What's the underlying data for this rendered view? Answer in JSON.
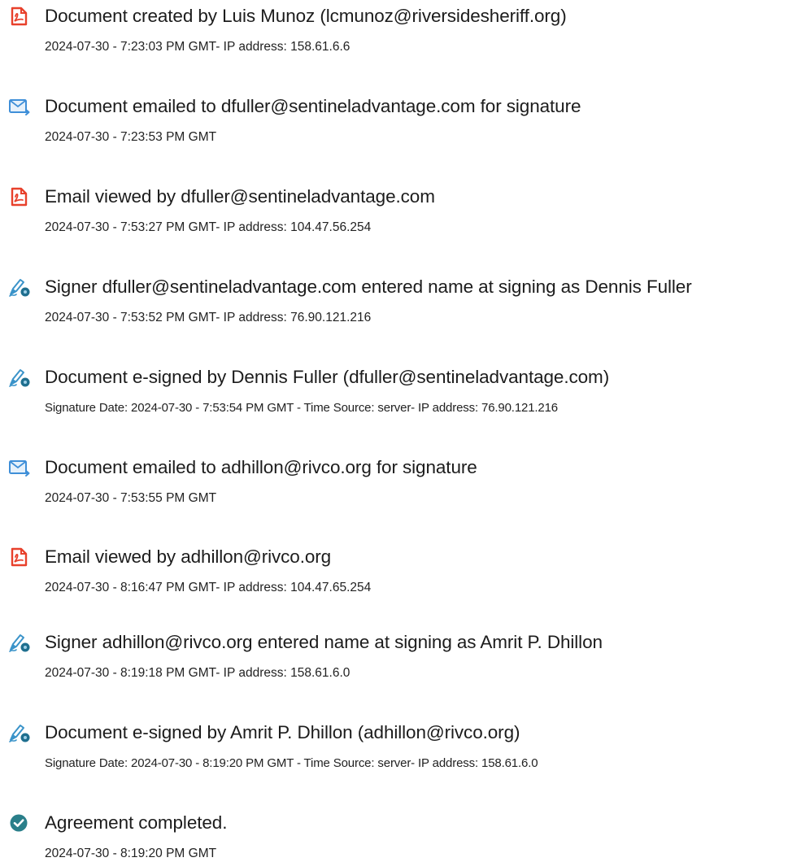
{
  "events": [
    {
      "icon": "pdf-document-icon",
      "title": "Document created by Luis Munoz (lcmunoz@riversidesheriff.org)",
      "detail": "2024-07-30 - 7:23:03 PM GMT- IP address: 158.61.6.6"
    },
    {
      "icon": "email-sent-icon",
      "title": "Document emailed to dfuller@sentineladvantage.com for signature",
      "detail": "2024-07-30 - 7:23:53 PM GMT"
    },
    {
      "icon": "pdf-document-icon",
      "title": "Email viewed by dfuller@sentineladvantage.com",
      "detail": "2024-07-30 - 7:53:27 PM GMT- IP address: 104.47.56.254"
    },
    {
      "icon": "signature-pen-icon",
      "title": "Signer dfuller@sentineladvantage.com entered name at signing as Dennis Fuller",
      "detail": "2024-07-30 - 7:53:52 PM GMT- IP address: 76.90.121.216"
    },
    {
      "icon": "signature-pen-icon",
      "title": "Document e-signed by Dennis Fuller (dfuller@sentineladvantage.com)",
      "detail": "Signature Date: 2024-07-30 - 7:53:54 PM GMT - Time Source: server- IP address: 76.90.121.216"
    },
    {
      "icon": "email-sent-icon",
      "title": "Document emailed to adhillon@rivco.org for signature",
      "detail": "2024-07-30 - 7:53:55 PM GMT"
    },
    {
      "icon": "pdf-document-icon",
      "title": "Email viewed by adhillon@rivco.org",
      "detail": "2024-07-30 - 8:16:47 PM GMT- IP address: 104.47.65.254"
    },
    {
      "icon": "signature-pen-icon",
      "title": "Signer adhillon@rivco.org entered name at signing as Amrit P. Dhillon",
      "detail": "2024-07-30 - 8:19:18 PM GMT- IP address: 158.61.6.0"
    },
    {
      "icon": "signature-pen-icon",
      "title": "Document e-signed by Amrit P. Dhillon (adhillon@rivco.org)",
      "detail": "Signature Date: 2024-07-30 - 8:19:20 PM GMT - Time Source: server- IP address: 158.61.6.0"
    },
    {
      "icon": "checkmark-circle-icon",
      "title": "Agreement completed.",
      "detail": "2024-07-30 - 8:19:20 PM GMT"
    }
  ],
  "colors": {
    "pdf_icon": "#e8412c",
    "email_icon": "#3f8fd8",
    "pen_icon": "#3a93c9",
    "pen_badge": "#1f6f8f",
    "check_icon": "#2a7f8a",
    "text": "#1c1c1c"
  }
}
